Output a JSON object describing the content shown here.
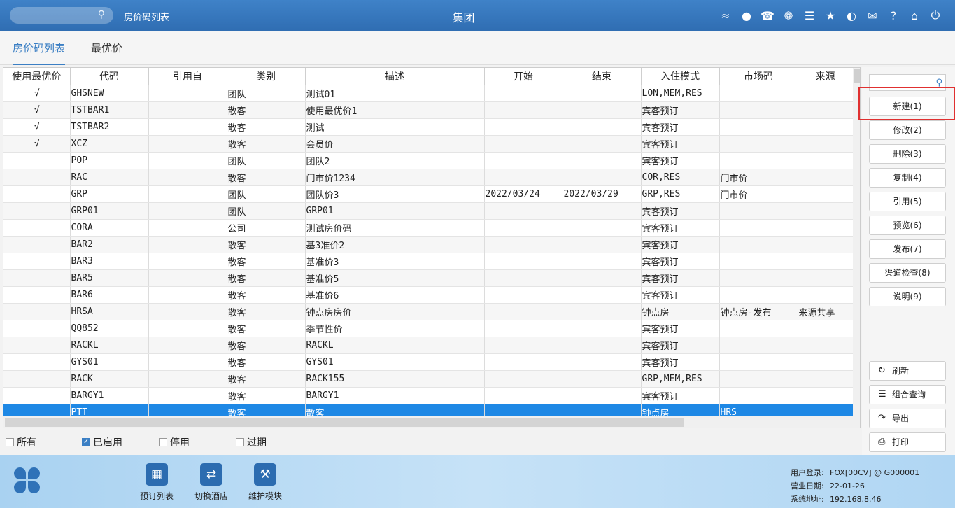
{
  "header": {
    "page_name": "房价码列表",
    "title": "集团",
    "icons": [
      "wifi-icon",
      "chat-icon",
      "phone-icon",
      "palette-icon",
      "menu-icon",
      "star-icon",
      "contrast-icon",
      "mail-icon",
      "help-icon",
      "home-icon",
      "power-icon"
    ]
  },
  "tabs": [
    {
      "label": "房价码列表",
      "active": true
    },
    {
      "label": "最优价",
      "active": false
    }
  ],
  "grid": {
    "columns": [
      "使用最优价",
      "代码",
      "引用自",
      "类别",
      "描述",
      "开始",
      "结束",
      "入住模式",
      "市场码",
      "来源"
    ],
    "rows": [
      [
        "√",
        "GHSNEW",
        "",
        "团队",
        "测试01",
        "",
        "",
        "LON,MEM,RES",
        "",
        ""
      ],
      [
        "√",
        "TSTBAR1",
        "",
        "散客",
        "使用最优价1",
        "",
        "",
        "宾客预订",
        "",
        ""
      ],
      [
        "√",
        "TSTBAR2",
        "",
        "散客",
        "测试",
        "",
        "",
        "宾客预订",
        "",
        ""
      ],
      [
        "√",
        "XCZ",
        "",
        "散客",
        "会员价",
        "",
        "",
        "宾客预订",
        "",
        ""
      ],
      [
        "",
        "POP",
        "",
        "团队",
        "团队2",
        "",
        "",
        "宾客预订",
        "",
        ""
      ],
      [
        "",
        "RAC",
        "",
        "散客",
        "门市价1234",
        "",
        "",
        "COR,RES",
        "门市价",
        ""
      ],
      [
        "",
        "GRP",
        "",
        "团队",
        "团队价3",
        "2022/03/24",
        "2022/03/29",
        "GRP,RES",
        "门市价",
        ""
      ],
      [
        "",
        "GRP01",
        "",
        "团队",
        "GRP01",
        "",
        "",
        "宾客预订",
        "",
        ""
      ],
      [
        "",
        "CORA",
        "",
        "公司",
        "测试房价码",
        "",
        "",
        "宾客预订",
        "",
        ""
      ],
      [
        "",
        "BAR2",
        "",
        "散客",
        "基3准价2",
        "",
        "",
        "宾客预订",
        "",
        ""
      ],
      [
        "",
        "BAR3",
        "",
        "散客",
        "基准价3",
        "",
        "",
        "宾客预订",
        "",
        ""
      ],
      [
        "",
        "BAR5",
        "",
        "散客",
        "基准价5",
        "",
        "",
        "宾客预订",
        "",
        ""
      ],
      [
        "",
        "BAR6",
        "",
        "散客",
        "基准价6",
        "",
        "",
        "宾客预订",
        "",
        ""
      ],
      [
        "",
        "HRSA",
        "",
        "散客",
        "钟点房房价",
        "",
        "",
        "钟点房",
        "钟点房-发布",
        "来源共享"
      ],
      [
        "",
        "QQ852",
        "",
        "散客",
        "季节性价",
        "",
        "",
        "宾客预订",
        "",
        ""
      ],
      [
        "",
        "RACKL",
        "",
        "散客",
        "RACKL",
        "",
        "",
        "宾客预订",
        "",
        ""
      ],
      [
        "",
        "GYS01",
        "",
        "散客",
        "GYS01",
        "",
        "",
        "宾客预订",
        "",
        ""
      ],
      [
        "",
        "RACK",
        "",
        "散客",
        "RACK155",
        "",
        "",
        "GRP,MEM,RES",
        "",
        ""
      ],
      [
        "",
        "BARGY1",
        "",
        "散客",
        "BARGY1",
        "",
        "",
        "宾客预订",
        "",
        ""
      ],
      [
        "",
        "PTT",
        "",
        "散客",
        "散客",
        "",
        "",
        "钟点房",
        "HRS",
        ""
      ]
    ],
    "selected_row": 19
  },
  "filters": [
    {
      "label": "所有",
      "checked": false
    },
    {
      "label": "已启用",
      "checked": true
    },
    {
      "label": "停用",
      "checked": false
    },
    {
      "label": "过期",
      "checked": false
    }
  ],
  "actions": [
    "新建(1)",
    "修改(2)",
    "删除(3)",
    "复制(4)",
    "引用(5)",
    "预览(6)",
    "发布(7)",
    "渠道检查(8)",
    "说明(9)"
  ],
  "tools": [
    {
      "label": "刷新",
      "icon": "refresh-icon"
    },
    {
      "label": "组合查询",
      "icon": "list-icon"
    },
    {
      "label": "导出",
      "icon": "export-icon"
    },
    {
      "label": "打印",
      "icon": "print-icon"
    }
  ],
  "modules": [
    {
      "label": "预订列表",
      "icon": "booking-list-icon"
    },
    {
      "label": "切换酒店",
      "icon": "switch-hotel-icon"
    },
    {
      "label": "维护模块",
      "icon": "wrench-icon"
    }
  ],
  "sysinfo": {
    "user_label": "用户登录:",
    "user_value": "FOX[00CV] @ G000001",
    "date_label": "营业日期:",
    "date_value": "22-01-26",
    "addr_label": "系统地址:",
    "addr_value": "192.168.8.46"
  },
  "colors": {
    "accent": "#3b7fc4",
    "selected_row": "#1e88e5",
    "highlight_border": "#e03030"
  }
}
